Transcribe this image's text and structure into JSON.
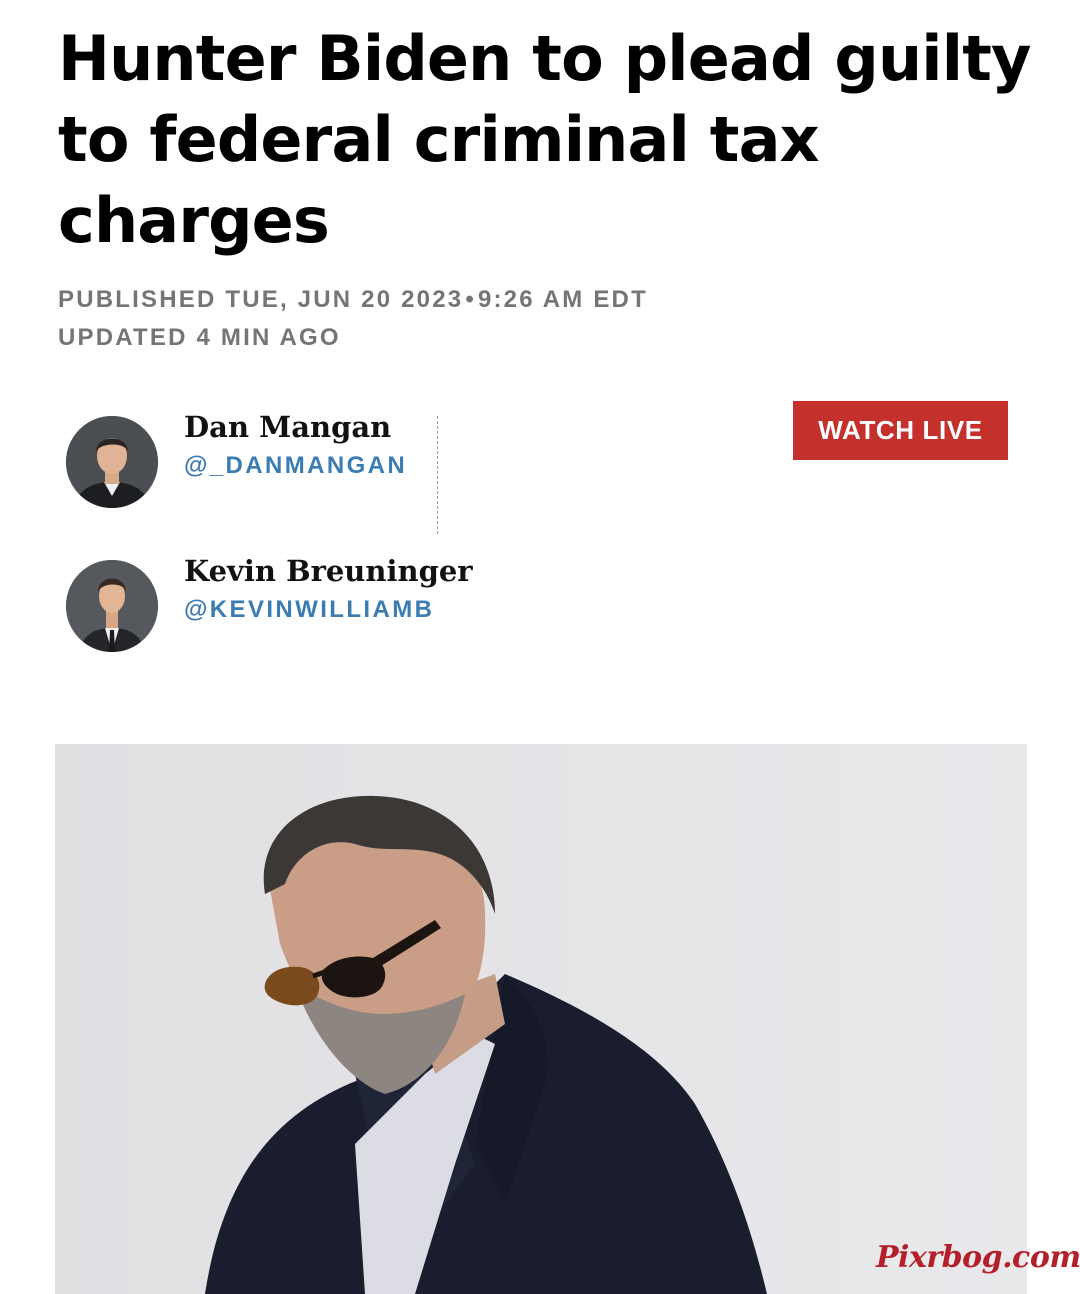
{
  "article": {
    "headline": "Hunter Biden to plead guilty to federal criminal tax charges",
    "published_label": "PUBLISHED TUE, JUN 20 2023",
    "separator": "•",
    "published_time": "9:26 AM EDT",
    "updated": "UPDATED 4 MIN AGO"
  },
  "authors": [
    {
      "name": "Dan Mangan",
      "handle": "@_DANMANGAN"
    },
    {
      "name": "Kevin Breuninger",
      "handle": "@KEVINWILLIAMB"
    }
  ],
  "watch_live": {
    "label": "WATCH LIVE",
    "color": "#c4302b"
  },
  "hero_image": {
    "subject": "man-in-sunglasses-and-dark-coat-photo"
  },
  "watermark": {
    "text": "Pixrbog.com",
    "color": "#b3202a"
  },
  "colors": {
    "handle": "#3b7cb3",
    "meta": "#757575"
  }
}
